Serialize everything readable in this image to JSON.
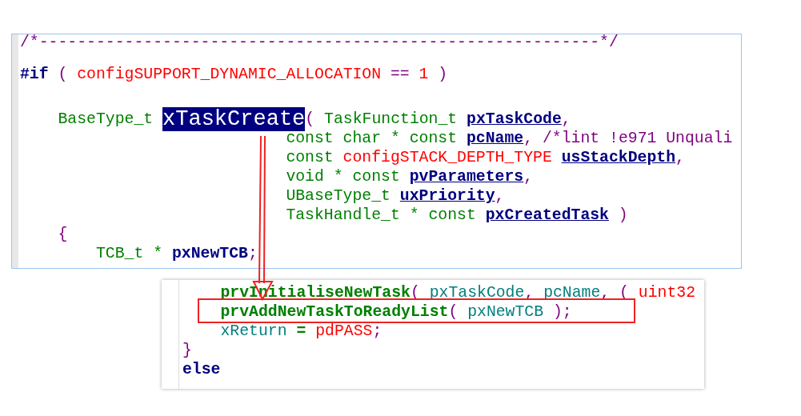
{
  "top_editor": {
    "lines": [
      {
        "tokens": [
          {
            "kind": "comment",
            "text": "/*-----------------------------------------------------------*/"
          }
        ]
      },
      {
        "kind": "gap"
      },
      {
        "tokens": [
          {
            "kind": "keyword",
            "text": "#if"
          },
          {
            "kind": "punct",
            "text": " ( "
          },
          {
            "kind": "macro",
            "text": "configSUPPORT_DYNAMIC_ALLOCATION"
          },
          {
            "kind": "punct",
            "text": " == "
          },
          {
            "kind": "macro",
            "text": "1"
          },
          {
            "kind": "punct",
            "text": " )"
          }
        ]
      },
      {
        "kind": "blank"
      },
      {
        "kind": "tall",
        "tokens": [
          {
            "kind": "type",
            "text": "    BaseType_t "
          },
          {
            "kind": "highlight",
            "text": "xTaskCreate"
          },
          {
            "kind": "punct",
            "text": "( "
          },
          {
            "kind": "type",
            "text": "TaskFunction_t "
          },
          {
            "kind": "param",
            "text": "pxTaskCode"
          },
          {
            "kind": "punct",
            "text": ","
          }
        ]
      },
      {
        "tokens": [
          {
            "kind": "type",
            "text": "                            const char * const "
          },
          {
            "kind": "param",
            "text": "pcName"
          },
          {
            "kind": "punct",
            "text": ", "
          },
          {
            "kind": "comment",
            "text": "/*lint !e971 Unquali"
          }
        ]
      },
      {
        "tokens": [
          {
            "kind": "type",
            "text": "                            const "
          },
          {
            "kind": "macro",
            "text": "configSTACK_DEPTH_TYPE "
          },
          {
            "kind": "param",
            "text": "usStackDepth"
          },
          {
            "kind": "punct",
            "text": ","
          }
        ]
      },
      {
        "tokens": [
          {
            "kind": "type",
            "text": "                            void * const "
          },
          {
            "kind": "param",
            "text": "pvParameters"
          },
          {
            "kind": "punct",
            "text": ","
          }
        ]
      },
      {
        "tokens": [
          {
            "kind": "type",
            "text": "                            UBaseType_t "
          },
          {
            "kind": "param",
            "text": "uxPriority"
          },
          {
            "kind": "punct",
            "text": ","
          }
        ]
      },
      {
        "tokens": [
          {
            "kind": "type",
            "text": "                            TaskHandle_t * const "
          },
          {
            "kind": "param",
            "text": "pxCreatedTask"
          },
          {
            "kind": "punct",
            "text": " )"
          }
        ]
      },
      {
        "tokens": [
          {
            "kind": "punct",
            "text": "    {"
          }
        ]
      },
      {
        "tokens": [
          {
            "kind": "type",
            "text": "        TCB_t * "
          },
          {
            "kind": "ident",
            "text": "pxNewTCB"
          },
          {
            "kind": "punct",
            "text": ";"
          }
        ]
      }
    ]
  },
  "bottom_editor": {
    "lines": [
      {
        "tokens": [
          {
            "kind": "func",
            "text": "    prvInitialiseNewTask"
          },
          {
            "kind": "punct",
            "text": "( "
          },
          {
            "kind": "var",
            "text": "pxTaskCode"
          },
          {
            "kind": "punct",
            "text": ", "
          },
          {
            "kind": "var",
            "text": "pcName"
          },
          {
            "kind": "punct",
            "text": ", ( "
          },
          {
            "kind": "macro",
            "text": "uint32"
          }
        ]
      },
      {
        "tokens": [
          {
            "kind": "func",
            "text": "    prvAddNewTaskToReadyList"
          },
          {
            "kind": "punct",
            "text": "( "
          },
          {
            "kind": "var",
            "text": "pxNewTCB"
          },
          {
            "kind": "punct",
            "text": " );"
          }
        ]
      },
      {
        "tokens": [
          {
            "kind": "var",
            "text": "    xReturn "
          },
          {
            "kind": "op",
            "text": "="
          },
          {
            "kind": "macro",
            "text": " pdPASS"
          },
          {
            "kind": "punct",
            "text": ";"
          }
        ]
      },
      {
        "tokens": [
          {
            "kind": "punct",
            "text": "}"
          }
        ]
      },
      {
        "tokens": [
          {
            "kind": "keyword",
            "text": "else"
          }
        ]
      }
    ]
  }
}
